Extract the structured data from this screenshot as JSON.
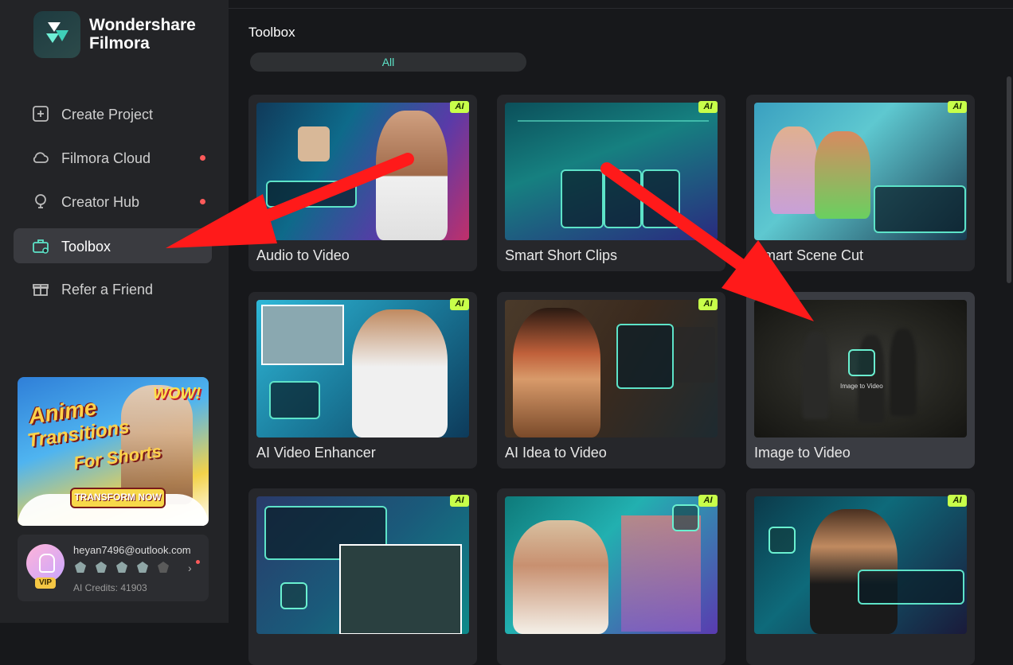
{
  "app": {
    "brand_line1": "Wondershare",
    "brand_line2": "Filmora"
  },
  "sidebar": {
    "items": [
      {
        "label": "Create Project",
        "icon": "plus-square-icon",
        "dot": false,
        "active": false
      },
      {
        "label": "Filmora Cloud",
        "icon": "cloud-icon",
        "dot": true,
        "active": false
      },
      {
        "label": "Creator Hub",
        "icon": "bulb-icon",
        "dot": true,
        "active": false
      },
      {
        "label": "Toolbox",
        "icon": "toolbox-icon",
        "dot": false,
        "active": true
      },
      {
        "label": "Refer a Friend",
        "icon": "gift-icon",
        "dot": false,
        "active": false
      }
    ],
    "banner": {
      "line1": "Anime",
      "line2": "Transitions",
      "line3": "For Shorts",
      "wow": "WOW!",
      "cta": "TRANSFORM NOW"
    },
    "account": {
      "email": "heyan7496@outlook.com",
      "vip": "VIP",
      "credits": "AI Credits: 41903"
    }
  },
  "main": {
    "title": "Toolbox",
    "filter": "All",
    "cards": [
      {
        "title": "Audio to Video",
        "ai": "AI"
      },
      {
        "title": "Smart Short Clips",
        "ai": "AI"
      },
      {
        "title": "Smart Scene Cut",
        "ai": "AI"
      },
      {
        "title": "AI Video Enhancer",
        "ai": "AI"
      },
      {
        "title": "AI Idea to Video",
        "ai": "AI"
      },
      {
        "title": "Image to Video",
        "ai": "",
        "overlay_label": "Image to Video"
      },
      {
        "title": "",
        "ai": "AI"
      },
      {
        "title": "",
        "ai": "AI"
      },
      {
        "title": "",
        "ai": "AI"
      }
    ]
  },
  "colors": {
    "accent": "#5de3c8",
    "ai_badge": "#c8ff4a",
    "annotation_arrow": "#ff1a1a",
    "notification_dot": "#ff5a5a"
  }
}
